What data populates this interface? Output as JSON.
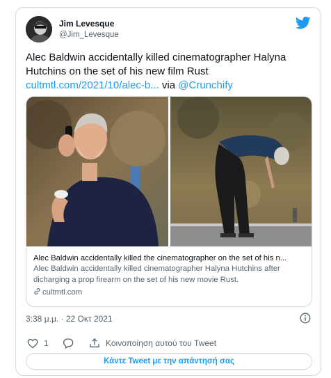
{
  "author": {
    "name": "Jim Levesque",
    "handle": "@Jim_Levesque",
    "avatar_icon": "avatar-photo"
  },
  "tweet": {
    "text": "Alec Baldwin accidentally killed cinematographer Halyna Hutchins on the set of his new film Rust",
    "link_text": "cultmtl.com/2021/10/alec-b...",
    "via_text": " via ",
    "mention": "@Crunchify"
  },
  "media_card": {
    "title": "Alec Baldwin accidentally killed the cinematographer on the set of his n...",
    "description": "Alec Baldwin accidentally killed cinematographer Halyna Hutchins after dicharging a prop firearm on the set of his new movie Rust.",
    "domain": "cultmtl.com"
  },
  "timestamp": "3:38 μ.μ. · 22 Οκτ 2021",
  "actions": {
    "like_count": "1",
    "share_label": "Κοινοποίηση αυτού του Tweet"
  },
  "reply_button": "Κάντε Tweet με την απάντησή σας",
  "colors": {
    "accent": "#1d9bf0",
    "secondary_text": "#536471",
    "border": "#cfd9de"
  },
  "icons": [
    "twitter-bird-icon",
    "info-icon",
    "heart-icon",
    "reply-icon",
    "share-icon",
    "link-icon"
  ]
}
